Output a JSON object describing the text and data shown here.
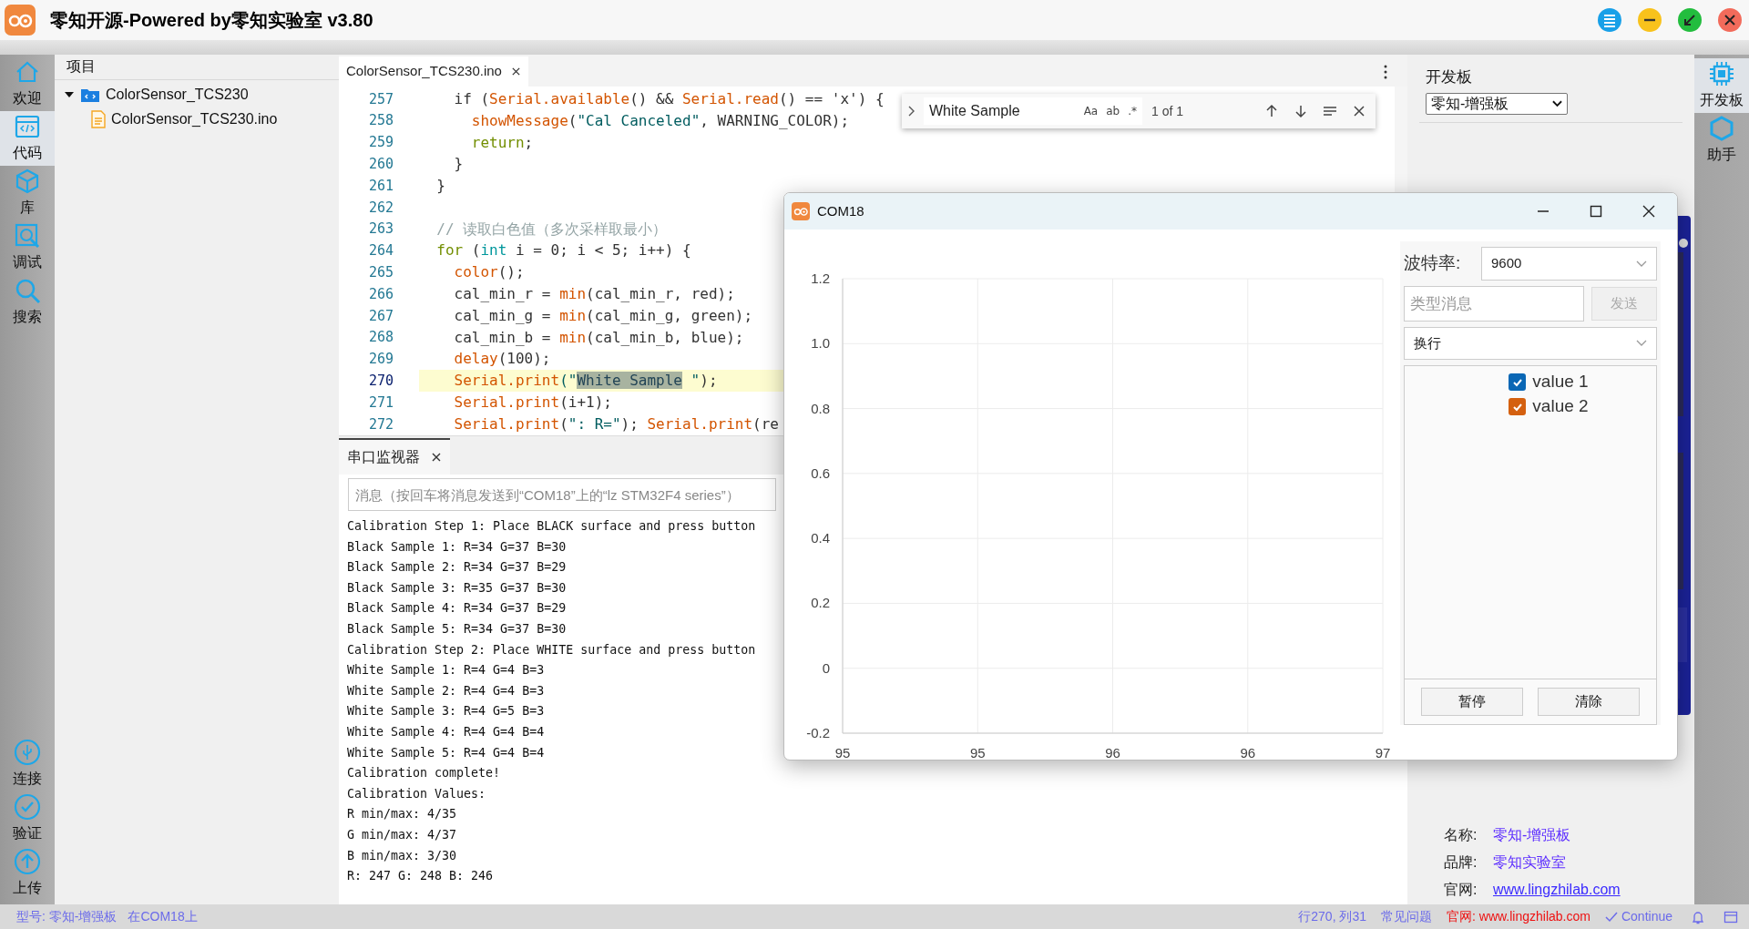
{
  "window": {
    "title": "零知开源-Powered by零知实验室 v3.80"
  },
  "left_sidebar": {
    "top": [
      {
        "label": "欢迎",
        "selected": false
      },
      {
        "label": "代码",
        "selected": true
      },
      {
        "label": "库",
        "selected": false
      },
      {
        "label": "调试",
        "selected": false
      },
      {
        "label": "搜索",
        "selected": false
      }
    ],
    "bottom": [
      {
        "label": "连接"
      },
      {
        "label": "验证"
      },
      {
        "label": "上传"
      }
    ]
  },
  "file_tree": {
    "header": "项目",
    "items": [
      {
        "label": "ColorSensor_TCS230",
        "kind": "folder",
        "expanded": true,
        "children": [
          {
            "label": "ColorSensor_TCS230.ino",
            "kind": "file"
          }
        ]
      }
    ]
  },
  "editor": {
    "tabs": [
      {
        "label": "ColorSensor_TCS230.ino",
        "selected": true
      }
    ],
    "find": {
      "value": "White Sample",
      "options": [
        "Aa",
        "ab",
        ".*"
      ],
      "result": "1 of 1"
    },
    "lines": [
      {
        "number": "257",
        "current": false,
        "segments": [
          {
            "text": "    if (",
            "kind": "plain"
          },
          {
            "text": "Serial.available",
            "kind": "function"
          },
          {
            "text": "() && ",
            "kind": "plain"
          },
          {
            "text": "Serial.read",
            "kind": "function"
          },
          {
            "text": "() == 'x') {",
            "kind": "plain"
          }
        ]
      },
      {
        "number": "258",
        "current": false,
        "segments": [
          {
            "text": "      showMessage",
            "kind": "function"
          },
          {
            "text": "(",
            "kind": "plain"
          },
          {
            "text": "\"Cal Canceled\"",
            "kind": "string"
          },
          {
            "text": ", WARNING_COLOR);",
            "kind": "plain"
          }
        ]
      },
      {
        "number": "259",
        "current": false,
        "segments": [
          {
            "text": "      return",
            "kind": "keyword"
          },
          {
            "text": ";",
            "kind": "plain"
          }
        ]
      },
      {
        "number": "260",
        "current": false,
        "segments": [
          {
            "text": "    }",
            "kind": "plain"
          }
        ]
      },
      {
        "number": "261",
        "current": false,
        "segments": [
          {
            "text": "  }",
            "kind": "plain"
          }
        ]
      },
      {
        "number": "262",
        "current": false
      },
      {
        "number": "263",
        "current": false,
        "segments": [
          {
            "text": "  // 读取白色值（多次采样取最小）",
            "kind": "comment"
          }
        ]
      },
      {
        "number": "264",
        "current": false,
        "segments": [
          {
            "text": "  for",
            "kind": "keyword"
          },
          {
            "text": " (",
            "kind": "plain"
          },
          {
            "text": "int",
            "kind": "type"
          },
          {
            "text": " i = 0; i < 5; i++) {",
            "kind": "plain"
          }
        ]
      },
      {
        "number": "265",
        "current": false,
        "segments": [
          {
            "text": "    color",
            "kind": "function"
          },
          {
            "text": "();",
            "kind": "plain"
          }
        ]
      },
      {
        "number": "266",
        "current": false,
        "segments": [
          {
            "text": "    cal_min_r = ",
            "kind": "plain"
          },
          {
            "text": "min",
            "kind": "function"
          },
          {
            "text": "(cal_min_r, red);",
            "kind": "plain"
          }
        ]
      },
      {
        "number": "267",
        "current": false,
        "segments": [
          {
            "text": "    cal_min_g = ",
            "kind": "plain"
          },
          {
            "text": "min",
            "kind": "function"
          },
          {
            "text": "(cal_min_g, green);",
            "kind": "plain"
          }
        ]
      },
      {
        "number": "268",
        "current": false,
        "segments": [
          {
            "text": "    cal_min_b = ",
            "kind": "plain"
          },
          {
            "text": "min",
            "kind": "function"
          },
          {
            "text": "(cal_min_b, blue);",
            "kind": "plain"
          }
        ]
      },
      {
        "number": "269",
        "current": false,
        "segments": [
          {
            "text": "    delay",
            "kind": "function"
          },
          {
            "text": "(100);",
            "kind": "plain"
          }
        ]
      },
      {
        "number": "270",
        "current": true,
        "segments": [
          {
            "text": "    Serial.print",
            "kind": "function"
          },
          {
            "text": "(\"",
            "kind": "string"
          },
          {
            "text": "White Sample",
            "kind": "match"
          },
          {
            "text": " \"",
            "kind": "string"
          },
          {
            "text": ");",
            "kind": "plain"
          }
        ]
      },
      {
        "number": "271",
        "current": false,
        "segments": [
          {
            "text": "    Serial.print",
            "kind": "function"
          },
          {
            "text": "(i+1);",
            "kind": "plain"
          }
        ]
      },
      {
        "number": "272",
        "current": false,
        "segments": [
          {
            "text": "    Serial.print",
            "kind": "function"
          },
          {
            "text": "(",
            "kind": "plain"
          },
          {
            "text": "\": R=\"",
            "kind": "string"
          },
          {
            "text": "); ",
            "kind": "plain"
          },
          {
            "text": "Serial.print",
            "kind": "function"
          },
          {
            "text": "(re",
            "kind": "plain"
          }
        ]
      }
    ]
  },
  "serial_monitor": {
    "tab": "串口监视器",
    "placeholder": "消息（按回车将消息发送到“COM18”上的“lz STM32F4 series”）",
    "output": [
      "Calibration Step 1: Place BLACK surface and press button",
      "Black Sample 1: R=34 G=37 B=30",
      "Black Sample 2: R=34 G=37 B=29",
      "Black Sample 3: R=35 G=37 B=30",
      "Black Sample 4: R=34 G=37 B=29",
      "Black Sample 5: R=34 G=37 B=30",
      "Calibration Step 2: Place WHITE surface and press button",
      "White Sample 1: R=4 G=4 B=3",
      "White Sample 2: R=4 G=4 B=3",
      "White Sample 3: R=4 G=5 B=3",
      "White Sample 4: R=4 G=4 B=4",
      "White Sample 5: R=4 G=4 B=4",
      "Calibration complete!",
      "Calibration Values:",
      "R min/max: 4/35",
      "G min/max: 4/37",
      "B min/max: 3/30",
      "R: 247 G: 248 B: 246"
    ]
  },
  "board_panel": {
    "label": "开发板",
    "selected_board": "零知-增强板",
    "info": [
      {
        "label": "名称:",
        "value": "零知-增强板",
        "kind": "text"
      },
      {
        "label": "品牌:",
        "value": "零知实验室",
        "kind": "text"
      },
      {
        "label": "官网:",
        "value": "www.lingzhilab.com",
        "kind": "link"
      }
    ]
  },
  "right_sidebar": [
    {
      "label": "开发板",
      "selected": true
    },
    {
      "label": "助手",
      "selected": false
    }
  ],
  "plotter": {
    "title": "COM18",
    "chart_data": {
      "type": "line",
      "grid": true,
      "xlim": [
        95,
        97
      ],
      "ylim": [
        -0.2,
        1.2
      ],
      "xticks": [
        {
          "value": 95,
          "label": "95"
        },
        {
          "value": 95.5,
          "label": "95"
        },
        {
          "value": 96,
          "label": "96"
        },
        {
          "value": 96.5,
          "label": "96"
        },
        {
          "value": 97,
          "label": "97"
        }
      ],
      "yticks": [
        {
          "value": -0.2,
          "label": "-0.2"
        },
        {
          "value": 0,
          "label": "0"
        },
        {
          "value": 0.2,
          "label": "0.2"
        },
        {
          "value": 0.4,
          "label": "0.4"
        },
        {
          "value": 0.6,
          "label": "0.6"
        },
        {
          "value": 0.8,
          "label": "0.8"
        },
        {
          "value": 1,
          "label": "1.0"
        },
        {
          "value": 1.2,
          "label": "1.2"
        }
      ]
    },
    "baud_label": "波特率:",
    "baud": "9600",
    "message_placeholder": "类型消息",
    "send_button": {
      "label": "发送",
      "disabled": true
    },
    "line_ending": "换行",
    "legend": [
      {
        "label": "value 1",
        "checked": true,
        "color": "#0a67b5"
      },
      {
        "label": "value 2",
        "checked": true,
        "color": "#d4600f"
      }
    ],
    "buttons": [
      "暂停",
      "清除"
    ]
  },
  "status_bar": {
    "board": "型号: 零知-增强板",
    "port": "在COM18上",
    "position": "行270, 列31",
    "faq": "常见问题",
    "website": "官网: www.lingzhilab.com",
    "continue": "Continue"
  }
}
